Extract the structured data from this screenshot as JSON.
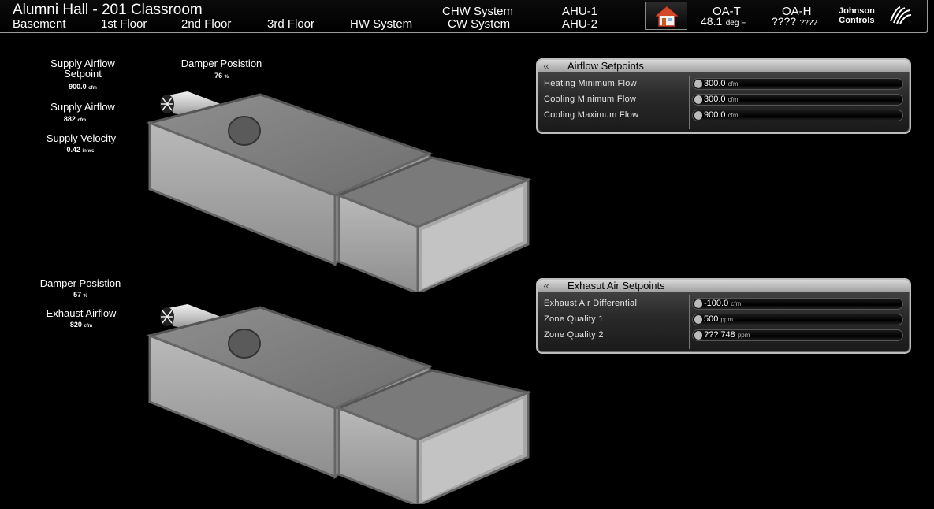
{
  "header": {
    "title": "Alumni Hall - 201 Classroom",
    "nav": [
      "Basement",
      "1st Floor",
      "2nd Floor",
      "3rd Floor",
      "HW System"
    ],
    "systems": [
      "CHW System",
      "CW System",
      "AHU-1",
      "AHU-2"
    ],
    "oa_t": {
      "label": "OA-T",
      "value": "48.1",
      "unit": "deg F"
    },
    "oa_h": {
      "label": "OA-H",
      "value": "????",
      "unit": "????"
    },
    "logo_line1": "Johnson",
    "logo_line2": "Controls"
  },
  "supply": {
    "setpoint_label": "Supply Airflow\nSetpoint",
    "setpoint_value": "900.0",
    "setpoint_unit": "cfm",
    "airflow_label": "Supply Airflow",
    "airflow_value": "882",
    "airflow_unit": "cfm",
    "velocity_label": "Supply Velocity",
    "velocity_value": "0.42",
    "velocity_unit": "in wc",
    "damper_label": "Damper Posistion",
    "damper_value": "76",
    "damper_unit": "%"
  },
  "exhaust": {
    "damper_label": "Damper Posistion",
    "damper_value": "57",
    "damper_unit": "%",
    "airflow_label": "Exhaust Airflow",
    "airflow_value": "820",
    "airflow_unit": "cfm"
  },
  "airflow_panel": {
    "title": "Airflow Setpoints",
    "rows": [
      {
        "label": "Heating Minimum Flow",
        "value": "300.0",
        "unit": "cfm"
      },
      {
        "label": "Cooling Minimum Flow",
        "value": "300.0",
        "unit": "cfm"
      },
      {
        "label": "Cooling Maximum Flow",
        "value": "900.0",
        "unit": "cfm"
      }
    ]
  },
  "exhaust_panel": {
    "title": "Exhasut Air Setpoints",
    "rows": [
      {
        "label": "Exhaust Air Differential",
        "value": "-100.0",
        "unit": "cfm"
      },
      {
        "label": "Zone Quality 1",
        "value": "500",
        "unit": "ppm"
      },
      {
        "label": "Zone Quality 2",
        "value": "??? 748",
        "unit": "ppm"
      }
    ]
  },
  "icons": {
    "home": "home-icon",
    "collapse": "double-chevron-left-icon",
    "fan": "fan-icon"
  },
  "colors": {
    "background": "#000000",
    "panel_header": "#c8c8c8",
    "duct": "#9c9c9c"
  }
}
